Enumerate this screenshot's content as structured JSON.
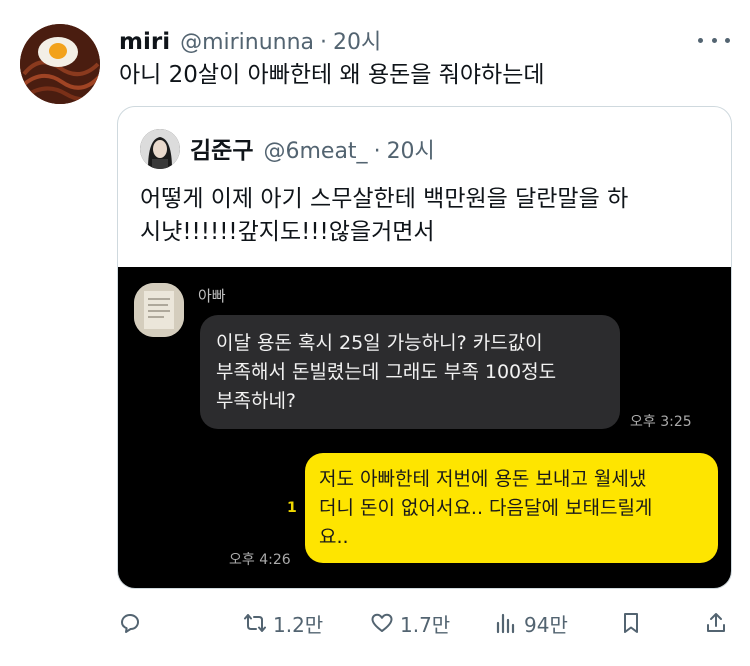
{
  "tweet": {
    "display_name": "miri",
    "handle": "@mirinunna",
    "separator": "·",
    "time": "20시",
    "text": "아니 20살이 아빠한테 왜 용돈을 줘야하는데"
  },
  "quote": {
    "display_name": "김준구",
    "handle": "@6meat_",
    "separator": "·",
    "time": "20시",
    "text_lines": [
      "어떻게 이제 아기 스무살한테 백만원을 달란말을 하",
      "시냣!!!!!!갚지도!!!않을거면서"
    ]
  },
  "chat": {
    "sender_name": "아빠",
    "incoming_lines": [
      "이달 용돈 혹시 25일  가능하니?  카드값이",
      "부족해서 돈빌렸는데 그래도 부족 100정도",
      "부족하네?"
    ],
    "incoming_time": "오후 3:25",
    "outgoing_lines": [
      "저도 아빠한테 저번에 용돈 보내고 월세냈",
      "더니 돈이 없어서요.. 다음달에 보태드릴게",
      "요.."
    ],
    "unread_count": "1",
    "outgoing_time": "오후 4:26"
  },
  "actions": {
    "reply": {
      "icon": "reply-icon"
    },
    "retweet": {
      "icon": "retweet-icon",
      "count": "1.2만"
    },
    "like": {
      "icon": "heart-icon",
      "count": "1.7만"
    },
    "views": {
      "icon": "views-icon",
      "count": "94만"
    },
    "bookmark": {
      "icon": "bookmark-icon"
    },
    "share": {
      "icon": "share-icon"
    }
  },
  "colors": {
    "secondary_text": "#536471",
    "bubble_incoming": "#2c2c2e",
    "bubble_outgoing": "#fee500",
    "chat_background": "#000000"
  }
}
